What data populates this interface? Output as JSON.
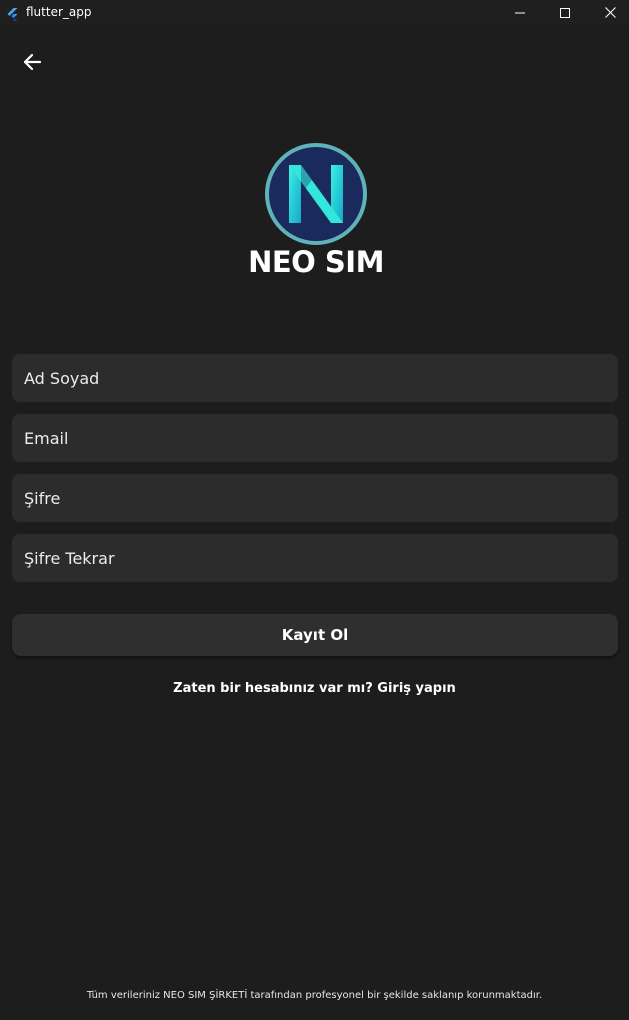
{
  "window": {
    "title": "flutter_app",
    "app_icon": "flutter-icon",
    "controls": [
      "minimize-icon",
      "maximize-icon",
      "close-icon"
    ]
  },
  "nav": {
    "back_icon": "arrow-left-icon"
  },
  "logo": {
    "text": "NEO SIM",
    "emblem_icon": "neo-n-emblem-icon"
  },
  "form": {
    "name_placeholder": "Ad Soyad",
    "email_placeholder": "Email",
    "password_placeholder": "Şifre",
    "password_repeat_placeholder": "Şifre Tekrar",
    "submit_label": "Kayıt Ol"
  },
  "login_link": "Zaten bir hesabınız var mı? Giriş yapın",
  "footer": "Tüm verileriniz NEO SIM ŞİRKETİ tarafından profesyonel bir şekilde saklanıp korunmaktadır.",
  "colors": {
    "background": "#1d1d1d",
    "field_background": "#2c2c2c",
    "button_background": "#2f2f2f",
    "logo_circle": "#1a2a5c",
    "logo_ring": "#5fb3b8",
    "logo_accent": "#2fe0d5",
    "text": "#ffffff"
  }
}
